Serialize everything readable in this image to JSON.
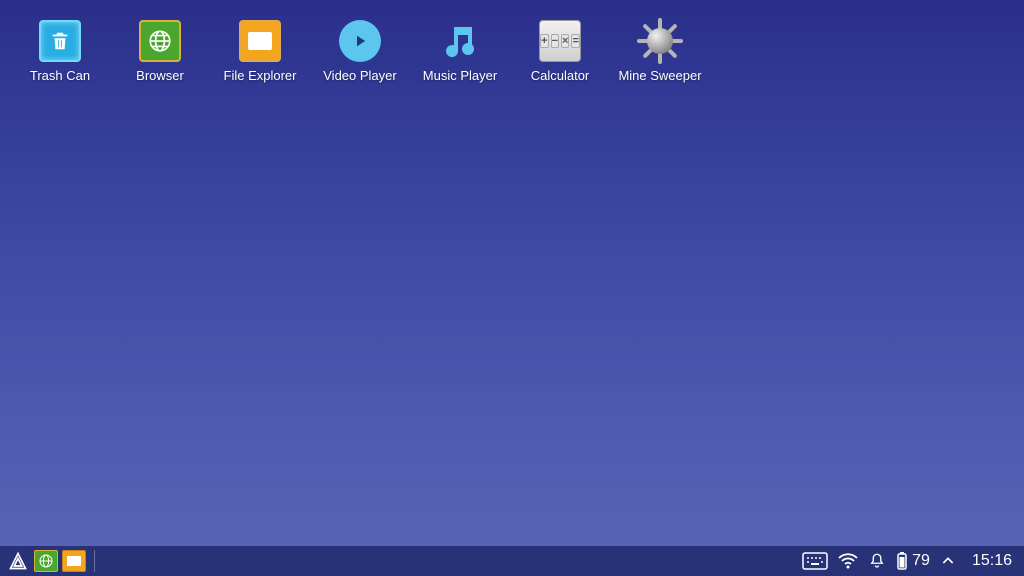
{
  "desktop": {
    "icons": [
      {
        "name": "trash-can",
        "label": "Trash Can"
      },
      {
        "name": "browser",
        "label": "Browser"
      },
      {
        "name": "file-explorer",
        "label": "File Explorer"
      },
      {
        "name": "video-player",
        "label": "Video Player"
      },
      {
        "name": "music-player",
        "label": "Music Player"
      },
      {
        "name": "calculator",
        "label": "Calculator"
      },
      {
        "name": "mine-sweeper",
        "label": "Mine Sweeper"
      }
    ]
  },
  "taskbar": {
    "pinned": [
      {
        "name": "start",
        "icon": "start-icon"
      },
      {
        "name": "browser",
        "icon": "browser-icon"
      },
      {
        "name": "file-explorer",
        "icon": "file-explorer-icon"
      }
    ],
    "battery_percent": "79",
    "clock": "15:16"
  }
}
